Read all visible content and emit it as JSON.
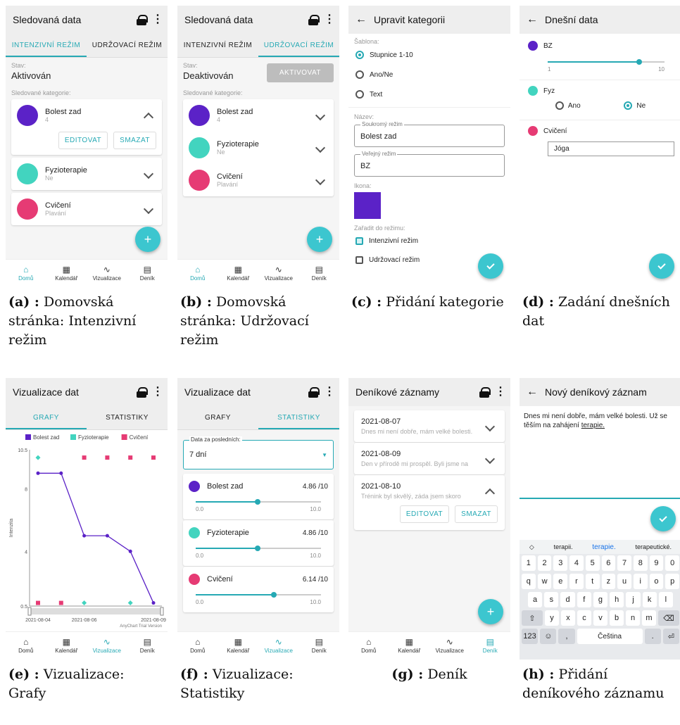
{
  "colors": {
    "accent": "#26a9b4",
    "purple": "#5b22c7",
    "teal": "#42d4bf",
    "pink": "#e63b74",
    "fab": "#3cc6cf"
  },
  "icons": {
    "lock": "lock-icon",
    "menu": "more-vert-icon",
    "back": "arrow-back-icon",
    "home": "home-icon",
    "calendar": "calendar-icon",
    "chart": "chart-line-icon",
    "diary": "notebook-icon",
    "add": "plus-icon",
    "check": "check-icon",
    "chevron": "chevron-down-icon"
  },
  "nav": {
    "home": "Domů",
    "calendar": "Kalendář",
    "viz": "Vizualizace",
    "diary": "Deník"
  },
  "a": {
    "title": "Sledovaná data",
    "tab1": "INTENZIVNÍ REŽIM",
    "tab2": "UDRŽOVACÍ REŽIM",
    "state_label": "Stav:",
    "state": "Aktivován",
    "cats_label": "Sledované kategorie:",
    "c1": "Bolest zad",
    "c1s": "4",
    "edit": "EDITOVAT",
    "del": "SMAZAT",
    "c2": "Fyzioterapie",
    "c2s": "Ne",
    "c3": "Cvičení",
    "c3s": "Plavání",
    "caption_tag": "(a) :",
    "caption": "Domovská stránka: Intenzivní režim"
  },
  "b": {
    "title": "Sledovaná data",
    "tab1": "INTENZIVNÍ REŽIM",
    "tab2": "UDRŽOVACÍ REŽIM",
    "state_label": "Stav:",
    "state": "Deaktivován",
    "activate": "AKTIVOVAT",
    "cats_label": "Sledované kategorie:",
    "c1": "Bolest zad",
    "c1s": "4",
    "c2": "Fyzioterapie",
    "c2s": "Ne",
    "c3": "Cvičení",
    "c3s": "Plavání",
    "caption_tag": "(b) :",
    "caption": "Domovská stránka: Udržovací režim"
  },
  "c": {
    "title": "Upravit kategorii",
    "template_label": "Šablona:",
    "r1": "Stupnice 1-10",
    "r2": "Ano/Ne",
    "r3": "Text",
    "name_label": "Název:",
    "private_label": "Soukromý režim",
    "private_val": "Bolest zad",
    "public_label": "Veřejný režim",
    "public_val": "BZ",
    "icon_label": "Ikona:",
    "mode_label": "Zařadit do režimu:",
    "m1": "Intenzivní režim",
    "m2": "Udržovací režim",
    "caption_tag": "(c) :",
    "caption": "Přidání kategorie"
  },
  "d": {
    "title": "Dnešní data",
    "c1": "BZ",
    "min": "1",
    "max": "10",
    "c2": "Fyz",
    "yes": "Ano",
    "no": "Ne",
    "c3": "Cvičení",
    "c3v": "Jóga",
    "caption_tag": "(d) :",
    "caption": "Zadání dnešních dat"
  },
  "e": {
    "title": "Vizualizace dat",
    "tab1": "GRAFY",
    "tab2": "STATISTIKY",
    "watermark": "AnyChart Trial Version",
    "caption_tag": "(e) :",
    "caption": "Vizualizace: Grafy"
  },
  "f": {
    "title": "Vizualizace dat",
    "tab1": "GRAFY",
    "tab2": "STATISTIKY",
    "period_label": "Data za posledních:",
    "period": "7 dní",
    "s1": "Bolest zad",
    "s1v": "4.86 /10",
    "s2": "Fyzioterapie",
    "s2v": "4.86 /10",
    "s3": "Cvičení",
    "s3v": "6.14 /10",
    "min": "0.0",
    "max": "10.0",
    "caption_tag": "(f) :",
    "caption": "Vizualizace: Statistiky"
  },
  "g": {
    "title": "Deníkové záznamy",
    "e1d": "2021-08-07",
    "e1t": "Dnes mi není dobře, mám velké bolesti.",
    "e2d": "2021-08-09",
    "e2t": "Den v přírodě mi prospěl. Byli jsme na",
    "e3d": "2021-08-10",
    "e3t": "Trénink byl skvělý, záda jsem skoro",
    "edit": "EDITOVAT",
    "del": "SMAZAT",
    "caption_tag": "(g) :",
    "caption": "Deník"
  },
  "h": {
    "title": "Nový deníkový záznam",
    "text": "Dnes mi není dobře, mám velké bolesti. Už se těším na zahájení ",
    "text_u": "terapie.",
    "sug1": "terapii.",
    "sug2": "terapie.",
    "sug3": "terapeutické.",
    "space": "Čeština",
    "caption_tag": "(h) :",
    "caption": "Přidání deníkového záznamu"
  },
  "chart_data": {
    "type": "line",
    "x": [
      "2021-08-04",
      "2021-08-05",
      "2021-08-06",
      "2021-08-07",
      "2021-08-08",
      "2021-08-09"
    ],
    "xticks": [
      "2021-08-04",
      "2021-08-06",
      "2021-08-09"
    ],
    "ylabel": "Intenzita",
    "yticks": [
      "10.5",
      "8",
      "4",
      "0.5"
    ],
    "ylim": [
      0.5,
      10.5
    ],
    "legend": "top",
    "series": [
      {
        "name": "Bolest zad",
        "type": "line",
        "color": "#5b22c7",
        "values": [
          9,
          9,
          5,
          5,
          4,
          0.7
        ]
      },
      {
        "name": "Fyzioterapie",
        "type": "marker-diamond",
        "color": "#42d4bf",
        "values": [
          10,
          null,
          0.7,
          null,
          0.7,
          null
        ]
      },
      {
        "name": "Cvičení",
        "type": "marker-square",
        "color": "#e63b74",
        "values": [
          0.7,
          0.7,
          10,
          10,
          10,
          10
        ]
      }
    ]
  }
}
